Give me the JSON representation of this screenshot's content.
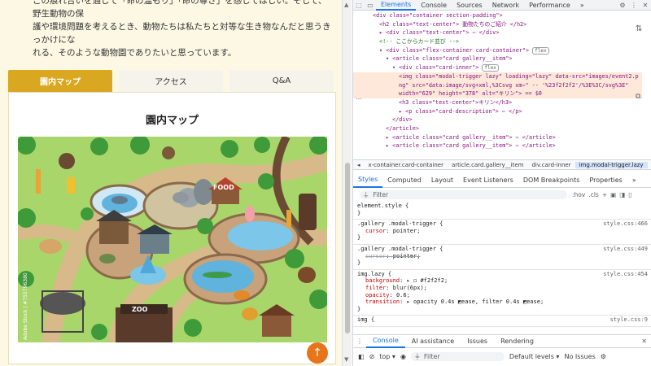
{
  "page": {
    "intro_lines": [
      "この痕れ合いを通じて「命の温もり」「命の尊さ」を感じてほしい。そして、野生動物の保",
      "護や環境問題を考えるとき、動物たちは私たちと対等な生き物なんだと思うきっかけにな",
      "れる、そのような動物園でありたいと思っています。"
    ],
    "tabs": [
      "園内マップ",
      "アクセス",
      "Q&A"
    ],
    "panel_title": "園内マップ",
    "map": {
      "food_sign": "FOOD",
      "zoo_sign": "ZOO",
      "credit": "Adobe Stock | #755796380"
    },
    "pagetop_icon": "↑"
  },
  "devtools": {
    "top_tabs": [
      "Elements",
      "Console",
      "Sources",
      "Network",
      "Performance",
      "»"
    ],
    "top_icons": [
      "inspect-icon",
      "device-icon",
      "gear-icon",
      "more-icon",
      "close-icon"
    ],
    "dom_lines": [
      {
        "indent": 2,
        "text": "<div class=\"container section-padding\">"
      },
      {
        "indent": 3,
        "text": "<h2 class=\"text-center\"> 動物たちのご紹介 </h2>"
      },
      {
        "indent": 3,
        "text": "▸ <div class=\"text-center\"> ⋯ </div>"
      },
      {
        "indent": 3,
        "text": "<!-- ここからカード並び -->"
      },
      {
        "indent": 3,
        "text": "▾ <div class=\"flex-container card-container\">",
        "badge": "flex"
      },
      {
        "indent": 4,
        "text": "▾ <article class=\"card gallery__item\">"
      },
      {
        "indent": 5,
        "text": "▾ <div class=\"card-inner\">",
        "badge": "flex"
      },
      {
        "indent": 6,
        "text": "<img class=\"modal-trigger lazy\" loading=\"lazy\" data-src=\"images/event2.p",
        "selected": true
      },
      {
        "indent": 6,
        "text": "ng\" src=\"data:image/svg+xml,%3Csvg xm⋯\" -- '%23f2f2f2'/%3E%3C/svg%3E\"",
        "selected": true
      },
      {
        "indent": 6,
        "text": "width=\"629\" height=\"378\" alt=\"キリン\"> == $0",
        "selected": true
      },
      {
        "indent": 6,
        "text": "<h3 class=\"text-center\">キリン</h3>"
      },
      {
        "indent": 6,
        "text": "▸ <p class=\"card-description\"> ⋯ </p>"
      },
      {
        "indent": 5,
        "text": "</div>"
      },
      {
        "indent": 4,
        "text": "</article>"
      },
      {
        "indent": 4,
        "text": "▸ <article class=\"card gallery__item\"> ⋯ </article>"
      },
      {
        "indent": 4,
        "text": "▸ <article class=\"card gallery__item\"> ⋯ </article>"
      }
    ],
    "breadcrumbs": [
      "◂",
      "x-container.card-container",
      "article.card.gallery__item",
      "div.card-inner",
      "img.modal-trigger.lazy",
      "▸"
    ],
    "sub_tabs": [
      "Styles",
      "Computed",
      "Layout",
      "Event Listeners",
      "DOM Breakpoints",
      "Properties",
      "»"
    ],
    "filter_placeholder": "Filter",
    "filter_tools": [
      ":hov",
      ".cls",
      "+"
    ],
    "style_rules": [
      {
        "selector": "element.style {",
        "source": "",
        "props": [],
        "close": "}"
      },
      {
        "selector": ".gallery .modal-trigger {",
        "source": "style.css:466",
        "props": [
          {
            "name": "cursor",
            "value": "pointer;",
            "strike": false
          }
        ],
        "close": "}"
      },
      {
        "selector": ".gallery .modal-trigger {",
        "source": "style.css:449",
        "props": [
          {
            "name": "cursor",
            "value": "pointer;",
            "strike": true
          }
        ],
        "close": "}"
      },
      {
        "selector": "img.lazy {",
        "source": "style.css:454",
        "props": [
          {
            "name": "background",
            "value": "▸ ◻ #f2f2f2;",
            "strike": false
          },
          {
            "name": "filter",
            "value": "blur(6px);",
            "strike": false
          },
          {
            "name": "opacity",
            "value": "0.6;",
            "strike": false
          },
          {
            "name": "transition",
            "value": "▸ opacity 0.4s ◩ease, filter 0.4s ◩ease;",
            "strike": false
          }
        ],
        "close": "}"
      },
      {
        "selector": "img {",
        "source": "style.css:9",
        "props": [],
        "close": ""
      }
    ],
    "drawer_tabs": [
      "Console",
      "AI assistance",
      "Issues",
      "Rendering"
    ],
    "console": {
      "context": "top",
      "filter_placeholder": "Filter",
      "levels": "Default levels",
      "issues": "No Issues"
    }
  },
  "colors": {
    "accent": "#d9a820",
    "pagetop": "#e8751a",
    "devtools_blue": "#1a73e8",
    "selected_row": "#fde8da"
  }
}
